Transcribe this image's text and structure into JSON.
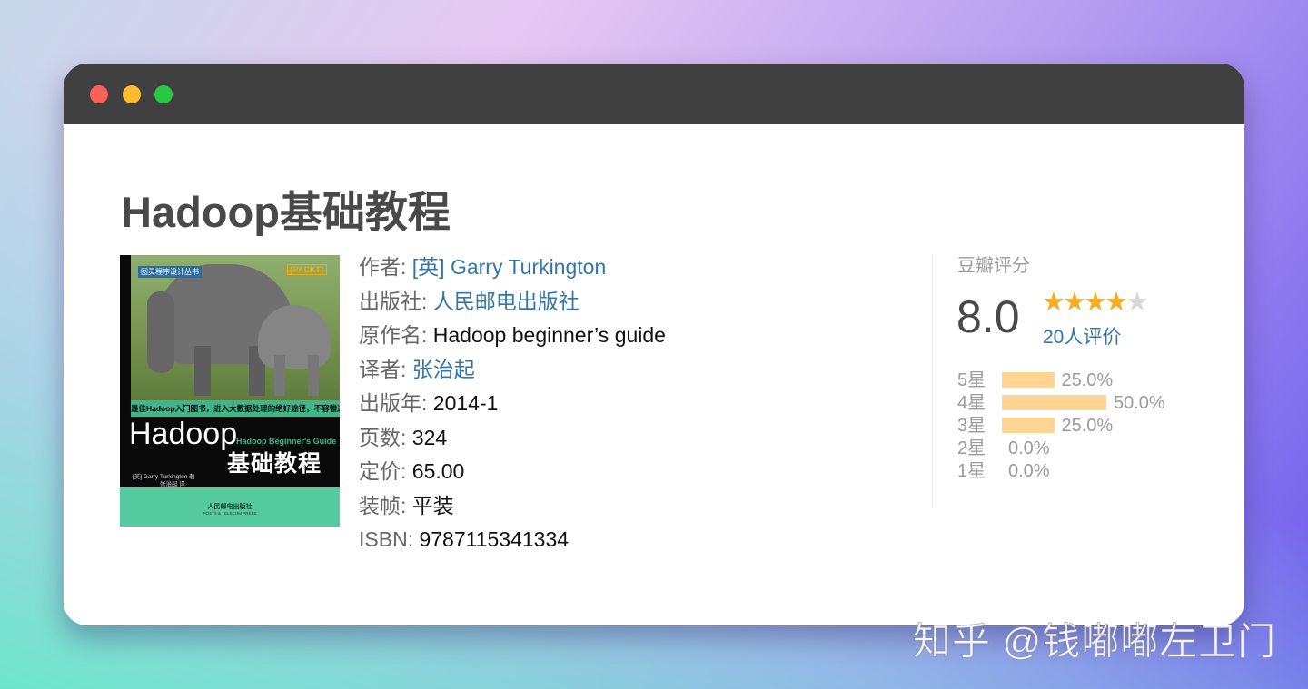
{
  "window": {
    "controls": {
      "close": "red",
      "minimize": "yellow",
      "maximize": "green"
    }
  },
  "book": {
    "title": "Hadoop基础教程",
    "cover": {
      "series": "图灵程序设计丛书",
      "pack": "[PACKT]",
      "strip": "最佳Hadoop入门图书，进入大数据处理的绝好途径，不容错过！",
      "title_en": "Hadoop",
      "subtitle_en": "Hadoop Beginner's Guide",
      "title_cn": "基础教程",
      "author": "[英] Garry Turkington  著",
      "translator": "张治起  译",
      "publisher": "人民邮电出版社",
      "publisher_en": "POSTS & TELECOM PRESS"
    },
    "info": {
      "author_label": "作者",
      "author_value": "[英] Garry Turkington",
      "publisher_label": "出版社",
      "publisher_value": "人民邮电出版社",
      "original_title_label": "原作名",
      "original_title_value": "Hadoop beginner’s guide",
      "translator_label": "译者",
      "translator_value": "张治起",
      "pub_year_label": "出版年",
      "pub_year_value": "2014-1",
      "pages_label": "页数",
      "pages_value": "324",
      "price_label": "定价",
      "price_value": "65.00",
      "binding_label": "装帧",
      "binding_value": "平装",
      "isbn_label": "ISBN",
      "isbn_value": "9787115341334",
      "separator": ": "
    }
  },
  "rating": {
    "heading": "豆瓣评分",
    "score": "8.0",
    "stars_filled": 4,
    "stars_total": 5,
    "count_text": "20人评价",
    "distribution": [
      {
        "label": "5星",
        "percent": 25.0,
        "percent_text": "25.0%"
      },
      {
        "label": "4星",
        "percent": 50.0,
        "percent_text": "50.0%"
      },
      {
        "label": "3星",
        "percent": 25.0,
        "percent_text": "25.0%"
      },
      {
        "label": "2星",
        "percent": 0.0,
        "percent_text": "0.0%"
      },
      {
        "label": "1星",
        "percent": 0.0,
        "percent_text": "0.0%"
      }
    ],
    "bar_color": "#ffd596",
    "star_color": "#f8ad20"
  },
  "watermark": "知乎 @钱嘟嘟左卫门",
  "colors": {
    "link": "#3377aa",
    "titlebar": "#404040"
  }
}
